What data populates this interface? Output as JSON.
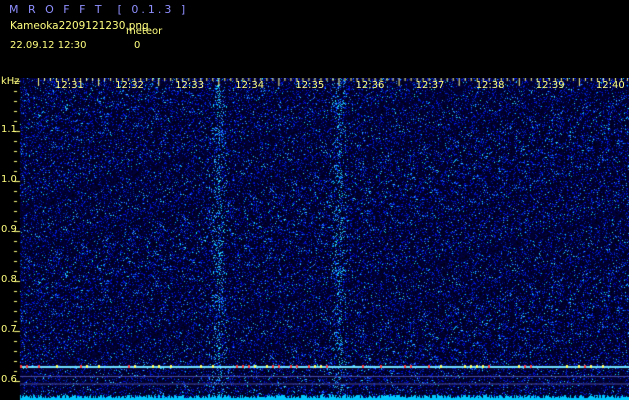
{
  "app": {
    "title": "M R O F F T  [ 0.1.3 ]"
  },
  "file": {
    "name": "Kameoka2209121230.png"
  },
  "meteor": {
    "label": "meteor",
    "count": "0"
  },
  "timestamp": "22.09.12 12:30",
  "colors": {
    "background": "#000000",
    "label": "#ffff80",
    "title": "#8f8fff",
    "noise": "#1a1a7a",
    "signal": "#00ffff"
  },
  "chart_data": {
    "type": "heatmap",
    "ylabel": "kHz",
    "x_ticks": [
      "12:31",
      "12:32",
      "12:33",
      "12:34",
      "12:35",
      "12:36",
      "12:37",
      "12:38",
      "12:39",
      "12:40"
    ],
    "y_ticks": [
      "1.1",
      "1.0",
      "0.9",
      "0.8",
      "0.7",
      "0.6"
    ],
    "y_values": [
      1.1,
      1.0,
      0.9,
      0.8,
      0.7,
      0.6
    ],
    "y_range": [
      0.58,
      1.2
    ],
    "carrier_khz": 0.63,
    "bright_times": [
      "12:33",
      "12:35"
    ]
  }
}
